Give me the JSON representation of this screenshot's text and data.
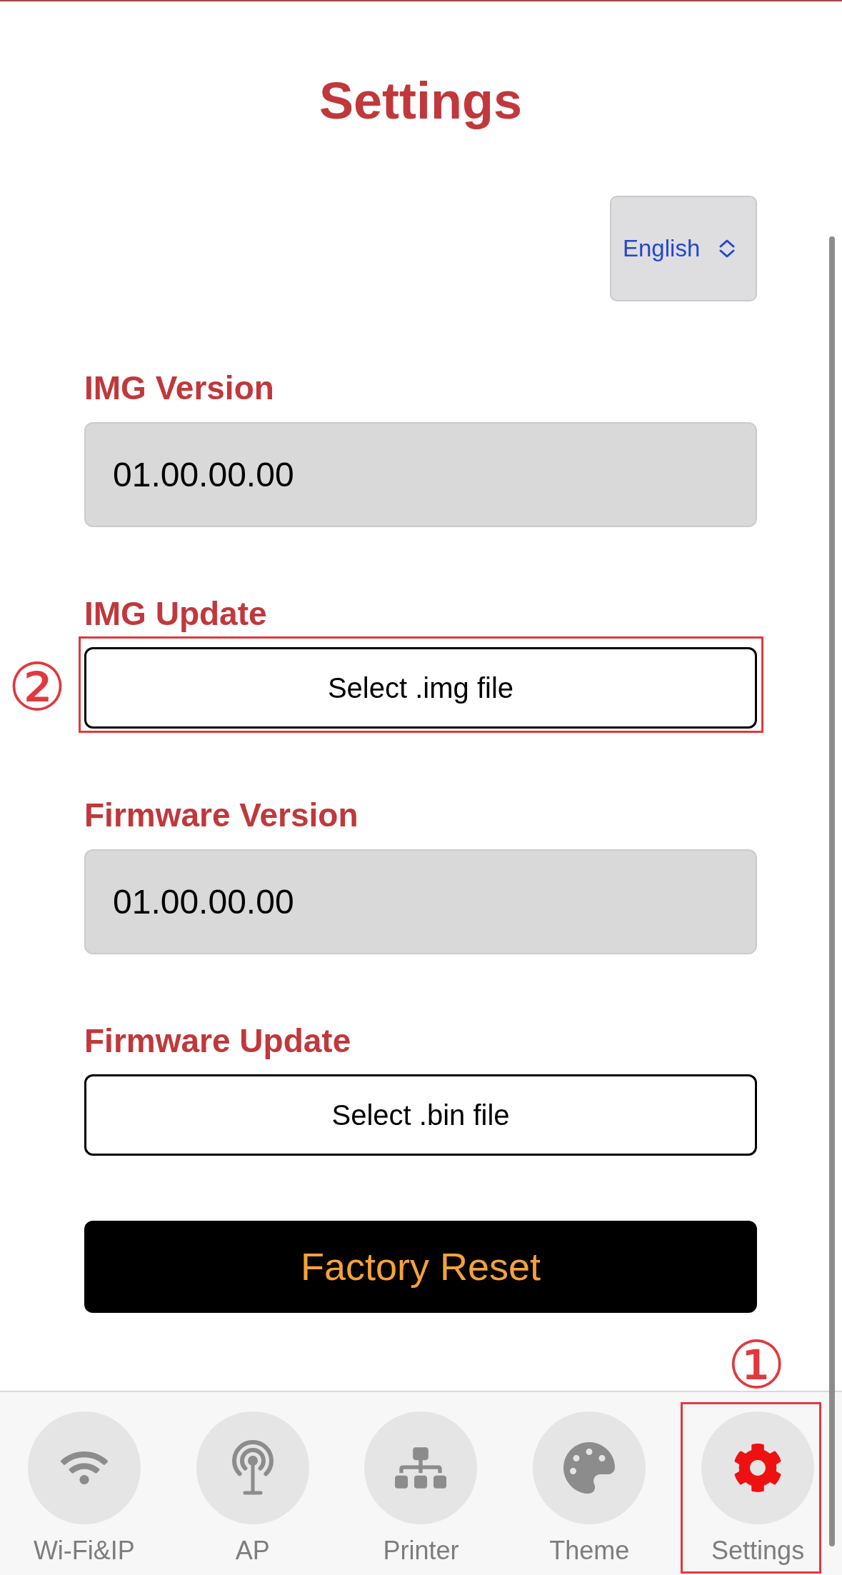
{
  "page": {
    "title": "Settings"
  },
  "language_select": {
    "value": "English"
  },
  "sections": [
    {
      "kind": "display",
      "label": "IMG Version",
      "value": "01.00.00.00"
    },
    {
      "kind": "file_picker",
      "label": "IMG Update",
      "button": "Select .img file",
      "annotation": "②"
    },
    {
      "kind": "display",
      "label": "Firmware Version",
      "value": "01.00.00.00"
    },
    {
      "kind": "file_picker",
      "label": "Firmware Update",
      "button": "Select .bin file"
    }
  ],
  "factory_reset_button": {
    "label": "Factory Reset"
  },
  "tab_bar": [
    {
      "label": "Wi-Fi&IP",
      "selected": false
    },
    {
      "label": "AP",
      "selected": false
    },
    {
      "label": "Printer",
      "selected": false
    },
    {
      "label": "Theme",
      "selected": false
    },
    {
      "label": "Settings",
      "selected": true,
      "annotation": "①"
    }
  ]
}
